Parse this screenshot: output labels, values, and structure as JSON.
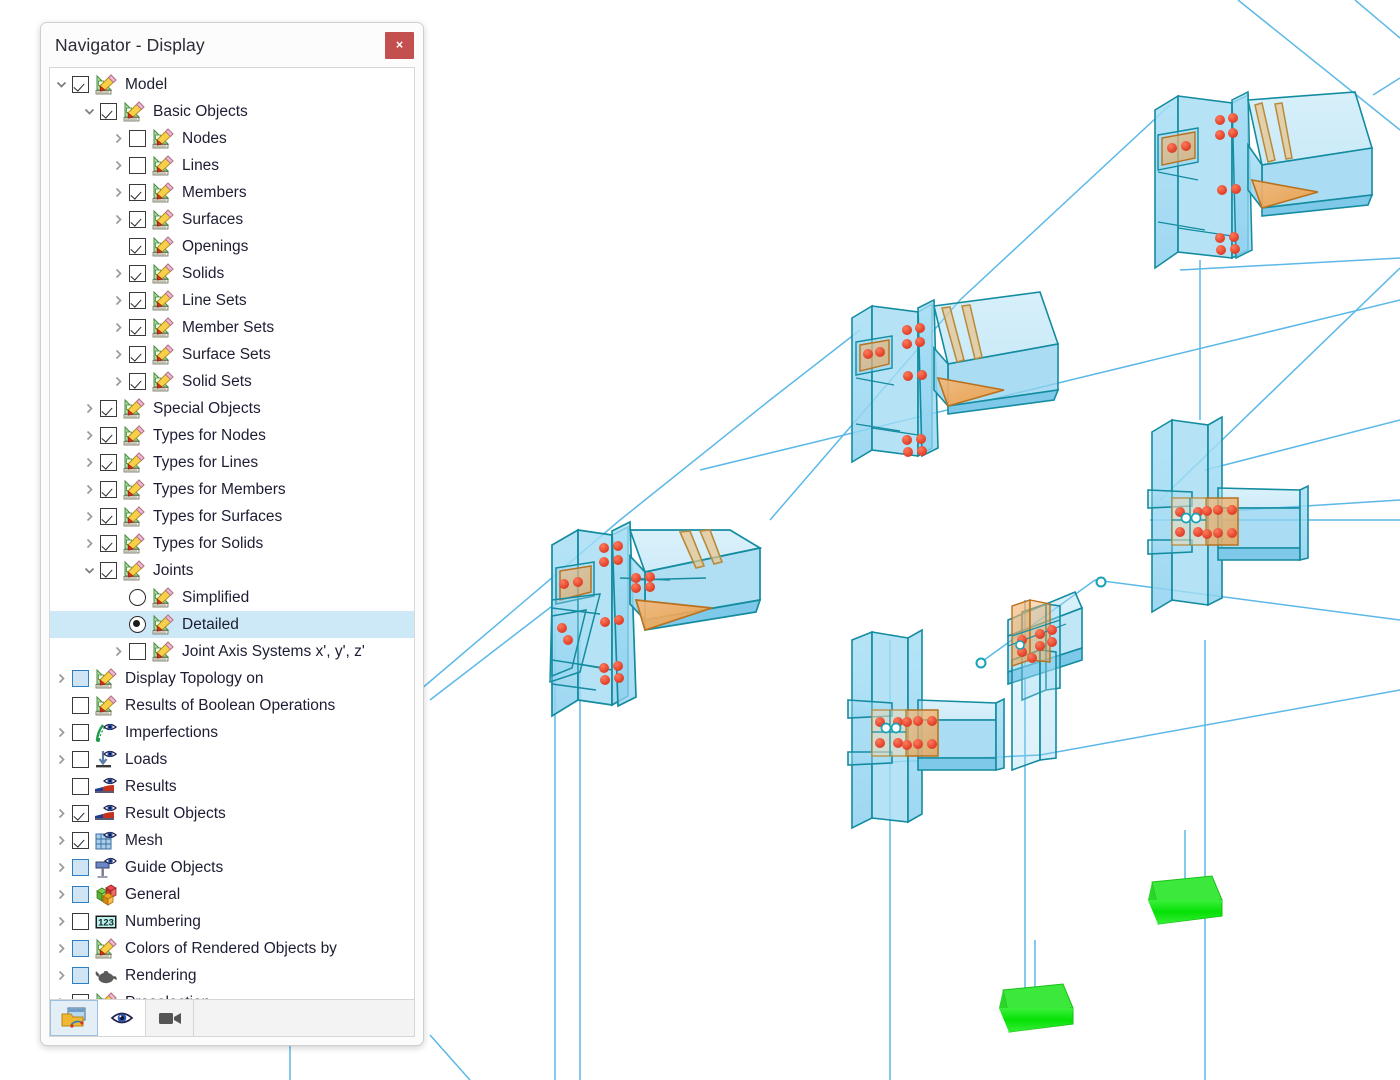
{
  "window": {
    "title": "Navigator - Display",
    "close_label": "×",
    "close_icon": "close-icon",
    "close_color": "#c3504e"
  },
  "theme": {
    "panel_bg": "#fcfcfc",
    "tree_bg": "#ffffff",
    "selection_bg": "#cde8f7",
    "text": "#1d1d33",
    "tristate_fill": "#cfe4f5",
    "tristate_border": "#2d7fc1",
    "model_edge": "#17a2b8",
    "model_face": "#8fd3f0",
    "plate_face": "#f0a050",
    "bolt": "#e8462f",
    "support": "#1de61d",
    "wire": "#5bb8e8"
  },
  "tree": [
    {
      "label": "Model",
      "indent": 0,
      "chevron": "down",
      "control": "checkbox",
      "state": "checked",
      "icon": "set-square-pencil-icon"
    },
    {
      "label": "Basic Objects",
      "indent": 1,
      "chevron": "down",
      "control": "checkbox",
      "state": "checked",
      "icon": "set-square-pencil-icon"
    },
    {
      "label": "Nodes",
      "indent": 2,
      "chevron": "right",
      "control": "checkbox",
      "state": "unchecked",
      "icon": "set-square-pencil-icon"
    },
    {
      "label": "Lines",
      "indent": 2,
      "chevron": "right",
      "control": "checkbox",
      "state": "unchecked",
      "icon": "set-square-pencil-icon"
    },
    {
      "label": "Members",
      "indent": 2,
      "chevron": "right",
      "control": "checkbox",
      "state": "checked",
      "icon": "set-square-pencil-icon"
    },
    {
      "label": "Surfaces",
      "indent": 2,
      "chevron": "right",
      "control": "checkbox",
      "state": "checked",
      "icon": "set-square-pencil-icon"
    },
    {
      "label": "Openings",
      "indent": 2,
      "chevron": "none",
      "control": "checkbox",
      "state": "checked",
      "icon": "set-square-pencil-icon"
    },
    {
      "label": "Solids",
      "indent": 2,
      "chevron": "right",
      "control": "checkbox",
      "state": "checked",
      "icon": "set-square-pencil-icon"
    },
    {
      "label": "Line Sets",
      "indent": 2,
      "chevron": "right",
      "control": "checkbox",
      "state": "checked",
      "icon": "set-square-pencil-icon"
    },
    {
      "label": "Member Sets",
      "indent": 2,
      "chevron": "right",
      "control": "checkbox",
      "state": "checked",
      "icon": "set-square-pencil-icon"
    },
    {
      "label": "Surface Sets",
      "indent": 2,
      "chevron": "right",
      "control": "checkbox",
      "state": "checked",
      "icon": "set-square-pencil-icon"
    },
    {
      "label": "Solid Sets",
      "indent": 2,
      "chevron": "right",
      "control": "checkbox",
      "state": "checked",
      "icon": "set-square-pencil-icon"
    },
    {
      "label": "Special Objects",
      "indent": 1,
      "chevron": "right",
      "control": "checkbox",
      "state": "checked",
      "icon": "set-square-pencil-icon"
    },
    {
      "label": "Types for Nodes",
      "indent": 1,
      "chevron": "right",
      "control": "checkbox",
      "state": "checked",
      "icon": "set-square-pencil-icon"
    },
    {
      "label": "Types for Lines",
      "indent": 1,
      "chevron": "right",
      "control": "checkbox",
      "state": "checked",
      "icon": "set-square-pencil-icon"
    },
    {
      "label": "Types for Members",
      "indent": 1,
      "chevron": "right",
      "control": "checkbox",
      "state": "checked",
      "icon": "set-square-pencil-icon"
    },
    {
      "label": "Types for Surfaces",
      "indent": 1,
      "chevron": "right",
      "control": "checkbox",
      "state": "checked",
      "icon": "set-square-pencil-icon"
    },
    {
      "label": "Types for Solids",
      "indent": 1,
      "chevron": "right",
      "control": "checkbox",
      "state": "checked",
      "icon": "set-square-pencil-icon"
    },
    {
      "label": "Joints",
      "indent": 1,
      "chevron": "down",
      "control": "checkbox",
      "state": "checked",
      "icon": "set-square-pencil-icon"
    },
    {
      "label": "Simplified",
      "indent": 2,
      "chevron": "none",
      "control": "radio",
      "state": "off",
      "icon": "set-square-pencil-icon"
    },
    {
      "label": "Detailed",
      "indent": 2,
      "chevron": "none",
      "control": "radio",
      "state": "on",
      "icon": "set-square-pencil-icon",
      "selected": true
    },
    {
      "label": "Joint Axis Systems x', y', z'",
      "indent": 2,
      "chevron": "right",
      "control": "checkbox",
      "state": "unchecked",
      "icon": "set-square-pencil-icon"
    },
    {
      "label": "Display Topology on",
      "indent": 0,
      "chevron": "right",
      "control": "checkbox",
      "state": "tristate",
      "icon": "set-square-pencil-icon"
    },
    {
      "label": "Results of Boolean Operations",
      "indent": 0,
      "chevron": "none",
      "control": "checkbox",
      "state": "unchecked",
      "icon": "set-square-pencil-icon"
    },
    {
      "label": "Imperfections",
      "indent": 0,
      "chevron": "right",
      "control": "checkbox",
      "state": "unchecked",
      "icon": "imperfection-eye-icon"
    },
    {
      "label": "Loads",
      "indent": 0,
      "chevron": "right",
      "control": "checkbox",
      "state": "unchecked",
      "icon": "load-arrow-eye-icon"
    },
    {
      "label": "Results",
      "indent": 0,
      "chevron": "none",
      "control": "checkbox",
      "state": "unchecked",
      "icon": "results-diagram-eye-icon"
    },
    {
      "label": "Result Objects",
      "indent": 0,
      "chevron": "right",
      "control": "checkbox",
      "state": "checked",
      "icon": "results-diagram-eye-icon"
    },
    {
      "label": "Mesh",
      "indent": 0,
      "chevron": "right",
      "control": "checkbox",
      "state": "checked",
      "icon": "mesh-grid-eye-icon"
    },
    {
      "label": "Guide Objects",
      "indent": 0,
      "chevron": "right",
      "control": "checkbox",
      "state": "tristate",
      "icon": "signpost-eye-icon"
    },
    {
      "label": "General",
      "indent": 0,
      "chevron": "right",
      "control": "checkbox",
      "state": "tristate",
      "icon": "color-cubes-icon"
    },
    {
      "label": "Numbering",
      "indent": 0,
      "chevron": "right",
      "control": "checkbox",
      "state": "unchecked",
      "icon": "numbering-123-icon"
    },
    {
      "label": "Colors of Rendered Objects by",
      "indent": 0,
      "chevron": "right",
      "control": "checkbox",
      "state": "tristate",
      "icon": "set-square-pencil-icon"
    },
    {
      "label": "Rendering",
      "indent": 0,
      "chevron": "right",
      "control": "checkbox",
      "state": "tristate",
      "icon": "teapot-icon"
    },
    {
      "label": "Preselection",
      "indent": 0,
      "chevron": "right",
      "control": "checkbox",
      "state": "checked",
      "icon": "set-square-pencil-icon"
    }
  ],
  "toolbar": [
    {
      "name": "navigator-model-tab",
      "icon": "folder-model-icon",
      "active": true
    },
    {
      "name": "navigator-display-tab",
      "icon": "eye-icon",
      "active": false
    },
    {
      "name": "navigator-views-tab",
      "icon": "video-camera-icon",
      "active": false
    }
  ],
  "model": {
    "description": "3D structural steel frame with detailed bolted joints",
    "joints": [
      {
        "name": "haunch-joint-top-right",
        "type": "moment-end-plate-with-haunch"
      },
      {
        "name": "haunch-joint-middle",
        "type": "moment-end-plate-with-haunch"
      },
      {
        "name": "haunch-joint-left",
        "type": "moment-end-plate-with-haunch"
      },
      {
        "name": "column-beam-joint-right",
        "type": "bolted-end-plate"
      },
      {
        "name": "column-beam-joint-lower",
        "type": "bolted-end-plate"
      },
      {
        "name": "beam-splice-joint",
        "type": "bolted-fin-plate"
      }
    ],
    "supports": [
      {
        "name": "nodal-support-1"
      },
      {
        "name": "nodal-support-2"
      }
    ]
  }
}
